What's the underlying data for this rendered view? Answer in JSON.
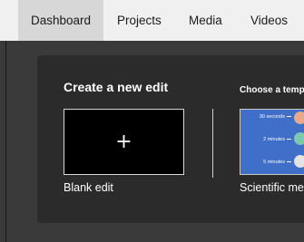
{
  "nav": {
    "tabs": [
      {
        "label": "Dashboard",
        "active": true
      },
      {
        "label": "Projects",
        "active": false
      },
      {
        "label": "Media",
        "active": false
      },
      {
        "label": "Videos",
        "active": false
      }
    ]
  },
  "create": {
    "heading": "Create a new edit",
    "blank_label": "Blank edit",
    "plus_icon": "+"
  },
  "templates": {
    "heading": "Choose a temp",
    "card": {
      "rows": [
        "30 seconds",
        "2 minutes",
        "5 minutes"
      ]
    },
    "label": "Scientific me"
  },
  "colors": {
    "nav_bg": "#f0f0f0",
    "nav_active_bg": "#d7d7d7",
    "page_bg": "#3a3a3a",
    "panel_bg": "#2b2b2b",
    "template_blue": "#3f6fc8"
  }
}
